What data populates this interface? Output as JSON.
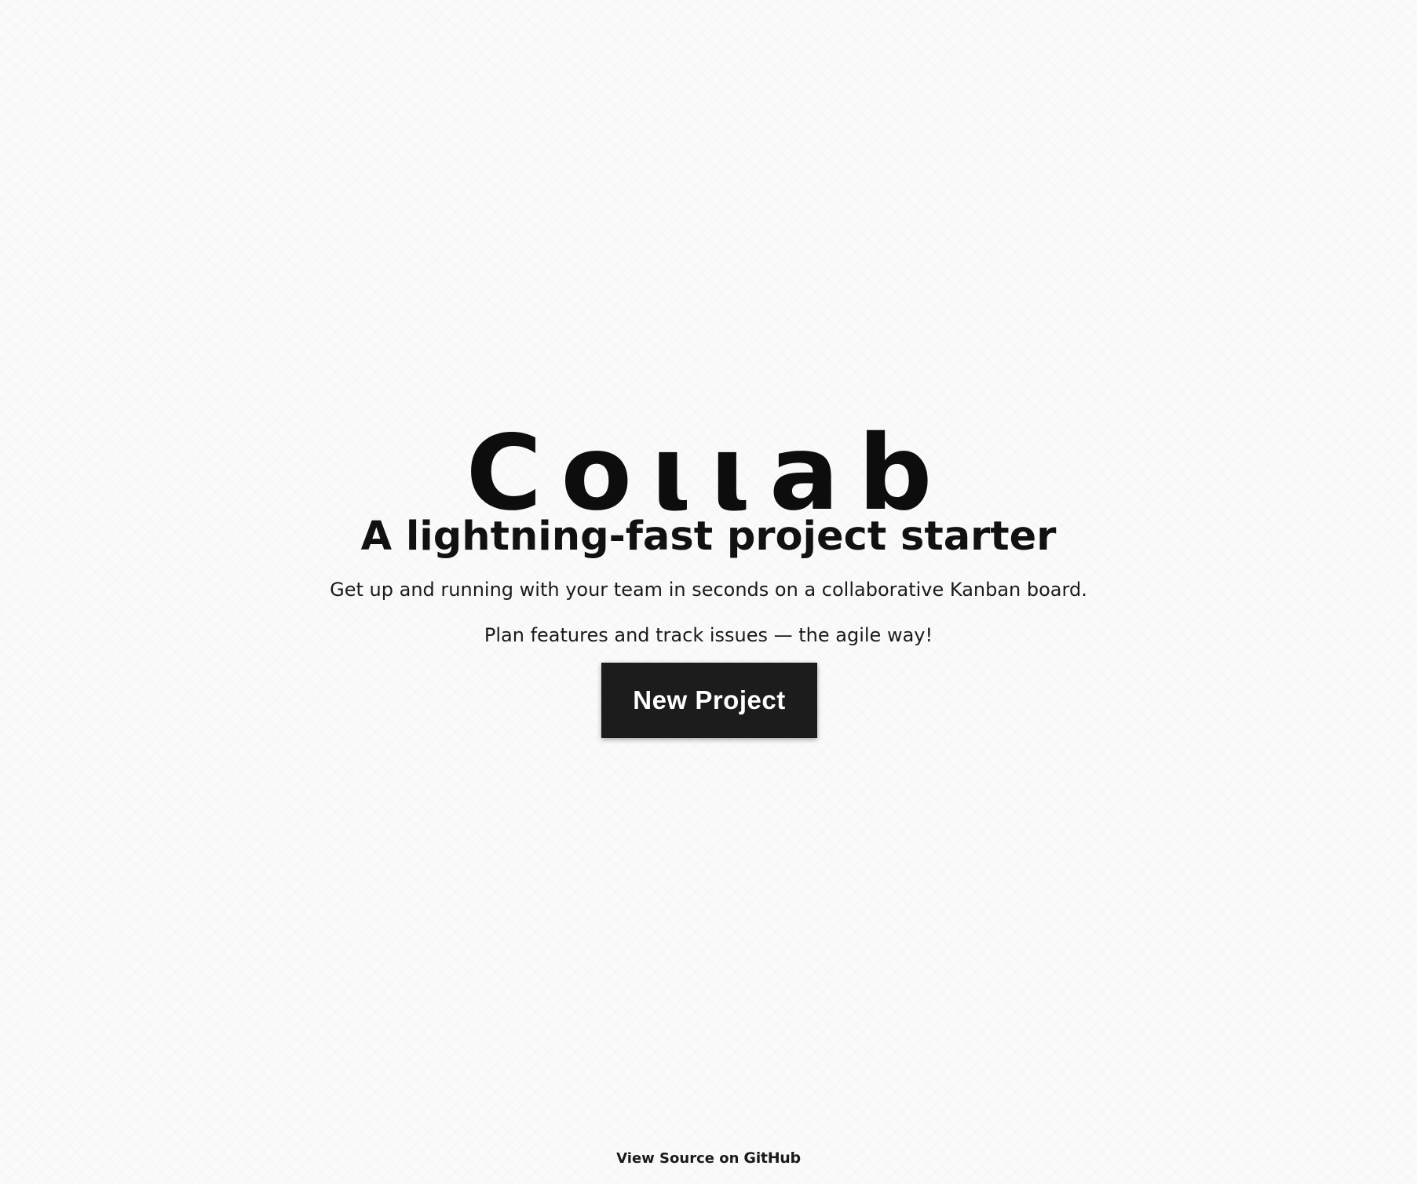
{
  "hero": {
    "logo": "Coιιab",
    "tagline": "A lightning-fast project starter",
    "description_1": "Get up and running with your team in seconds on a collaborative Kanban board.",
    "description_2": "Plan features and track issues — the agile way!",
    "cta_label": "New Project"
  },
  "footer": {
    "prefix": "View Source on",
    "link_text": "GitHub"
  },
  "colors": {
    "background": "#fafafa",
    "text": "#111111",
    "button_bg": "#1c1c1c",
    "button_text": "#ffffff"
  }
}
